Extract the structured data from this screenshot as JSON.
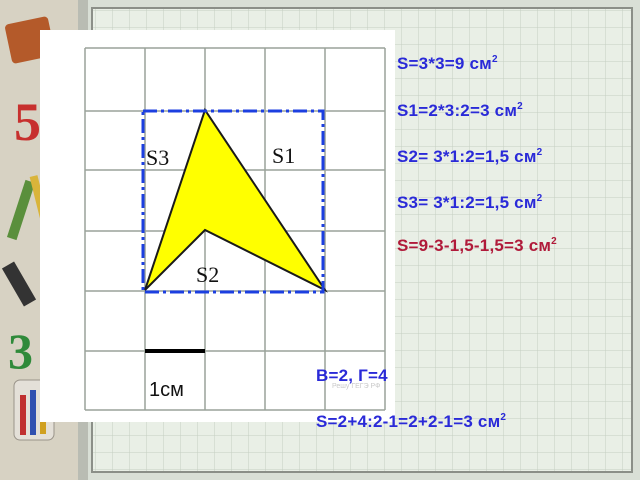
{
  "formulas": {
    "s_total": "S=3*3=9 см",
    "s1": "S1=2*3:2=3 см",
    "s2": "S2= 3*1:2=1,5 см",
    "s3": "S3= 3*1:2=1,5 см",
    "result": "S=9-3-1,5-1,5=3 см",
    "bg": "В=2, Г=4",
    "pick": "S=2+4:2-1=2+2-1=3 см",
    "exponent": "2"
  },
  "figure": {
    "label_s1": "S1",
    "label_s2": "S2",
    "label_s3": "S3",
    "scale_label": "1см"
  },
  "watermark": "Решу ГЕГЭ РФ",
  "colors": {
    "formula_blue": "#2a2ad8",
    "formula_red": "#b01a3a",
    "shape_fill": "#ffff00",
    "dash_line": "#1c3fe0",
    "grid_line": "#9aa29a"
  }
}
